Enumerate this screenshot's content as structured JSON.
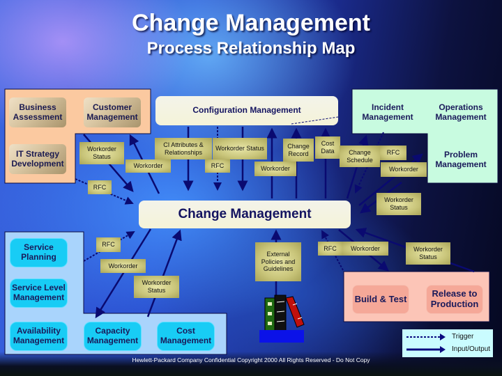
{
  "header": {
    "title": "Change Management",
    "subtitle": "Process Relationship Map"
  },
  "regions": {
    "business": {
      "color": "#fbc9a0"
    },
    "operations": {
      "color": "#c8fbe0"
    },
    "service": {
      "color": "#a9d4fc"
    },
    "release": {
      "color": "#fcc5b7"
    }
  },
  "processes": {
    "business_assessment": "Business Assessment",
    "customer_management": "Customer Management",
    "it_strategy": "IT Strategy Development",
    "configuration_management": "Configuration Management",
    "incident_management": "Incident Management",
    "operations_management": "Operations Management",
    "problem_management": "Problem Management",
    "change_management": "Change Management",
    "service_planning": "Service Planning",
    "service_level_management": "Service Level Management",
    "availability_management": "Availability Management",
    "capacity_management": "Capacity Management",
    "cost_management": "Cost Management",
    "build_test": "Build & Test",
    "release_production": "Release to Production"
  },
  "flow_labels": {
    "workorder_status_1": "Workorder Status",
    "workorder_1": "Workorder",
    "ci_attributes": "CI Attributes & Relationships",
    "rfc_1": "RFC",
    "workorder_status_2": "Workorder Status",
    "workorder_2": "Workorder",
    "change_record": "Change Record",
    "cost_data": "Cost Data",
    "change_schedule": "Change Schedule",
    "rfc_2": "RFC",
    "workorder_3": "Workorder",
    "rfc_3": "RFC",
    "workorder_status_3": "Workorder Status",
    "rfc_4": "RFC",
    "workorder_4": "Workorder",
    "workorder_status_4": "Workorder Status",
    "external_policies": "External Policies and Guidelines",
    "rfc_5": "RFC",
    "workorder_5": "Workorder",
    "workorder_status_5": "Workorder Status"
  },
  "library_icon": {
    "name": "books-icon",
    "label": ""
  },
  "legend": {
    "trigger": "Trigger",
    "input_output": "Input/Output"
  },
  "footer": "Hewlett-Packard Company Confidential Copyright 2000 All Rights Reserved - Do Not Copy"
}
